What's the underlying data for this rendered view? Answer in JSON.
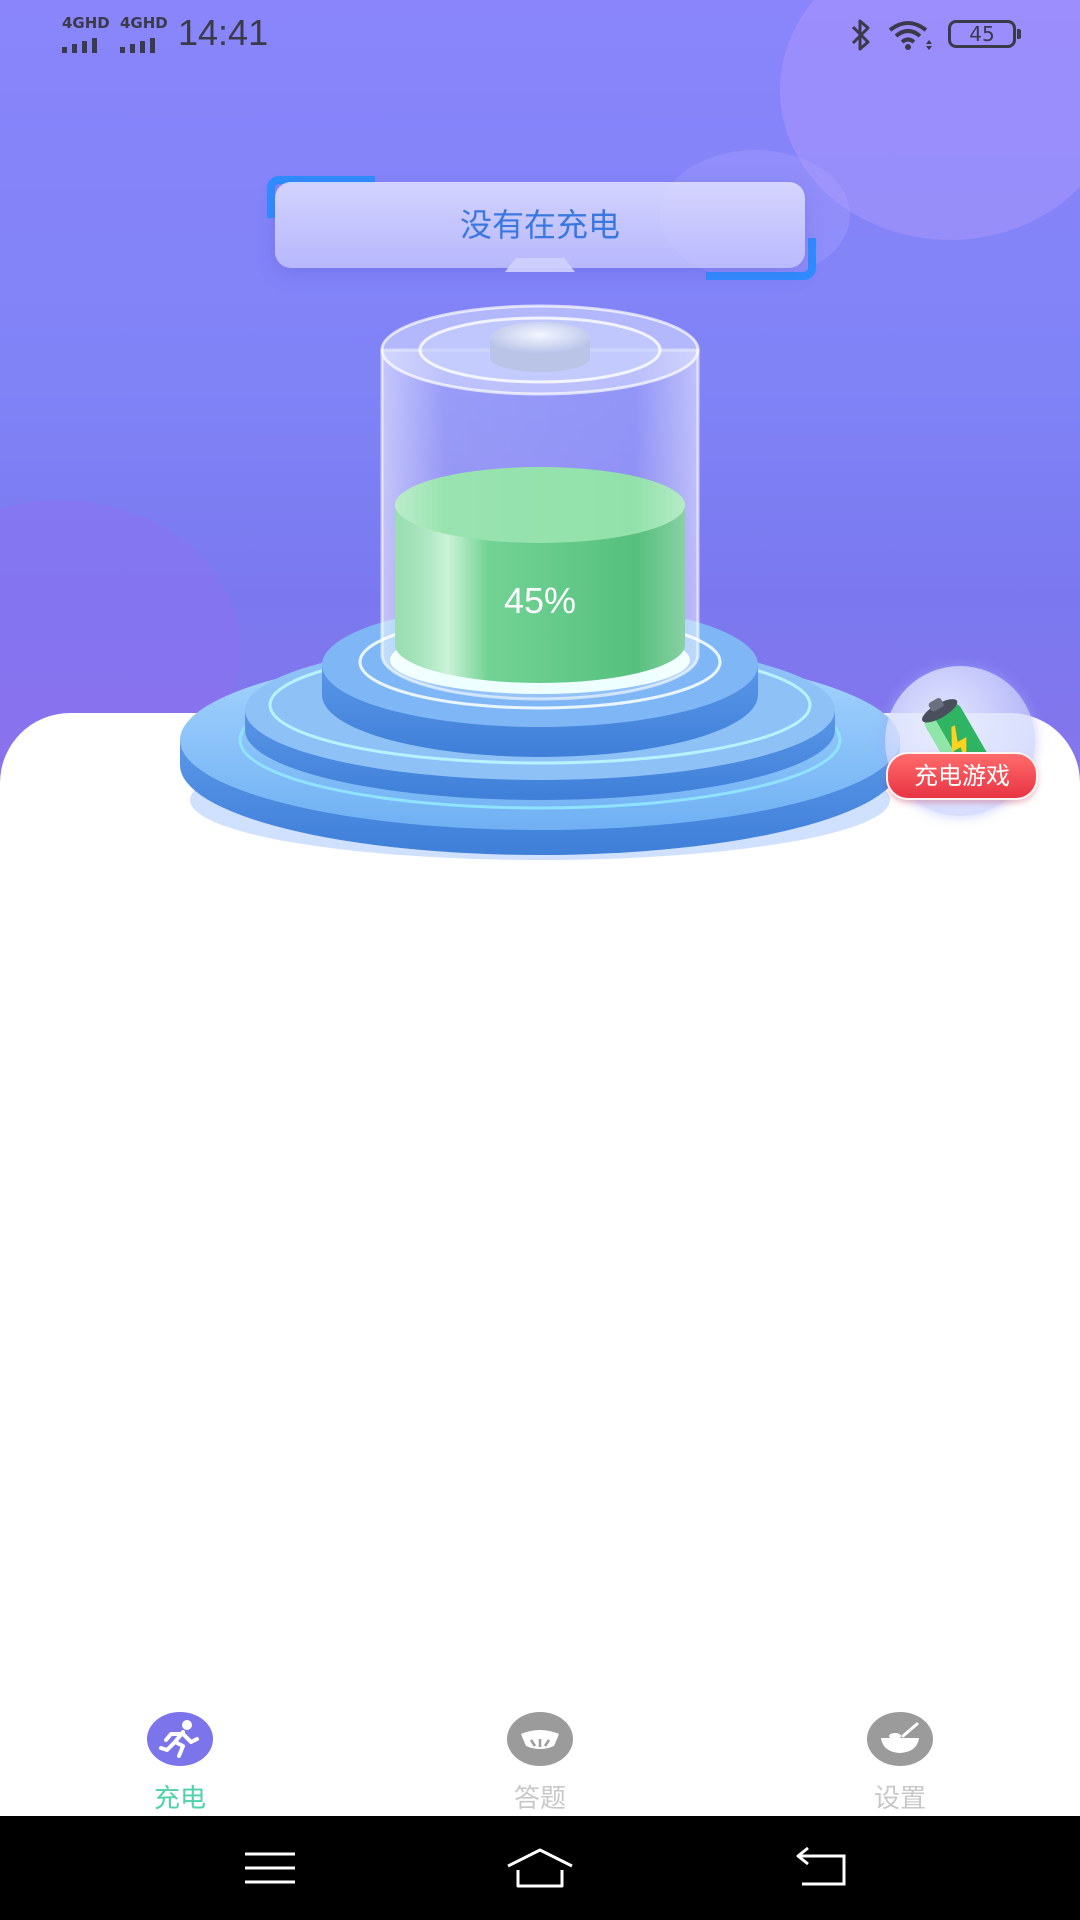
{
  "status_bar": {
    "signal1_label": "4GHD",
    "signal2_label": "4GHD",
    "time": "14:41",
    "battery_level": "45"
  },
  "charging": {
    "status_text": "没有在充电",
    "percent_text": "45%",
    "battery_fill": 0.45
  },
  "game_badge": {
    "label": "充电游戏"
  },
  "tabs": [
    {
      "label": "充电",
      "icon": "running-person-icon",
      "active": true
    },
    {
      "label": "答题",
      "icon": "quiz-bowl-icon",
      "active": false
    },
    {
      "label": "设置",
      "icon": "settings-bowl-icon",
      "active": false
    }
  ],
  "colors": {
    "accent_green": "#4fd3a4",
    "tab_active_bg": "#7b74ea",
    "tab_inactive_bg": "#9b9b9b",
    "banner_text": "#3a78e0",
    "badge_red": "#e83444"
  },
  "nav": {
    "menu_icon": "menu-icon",
    "home_icon": "home-icon",
    "back_icon": "back-icon"
  }
}
